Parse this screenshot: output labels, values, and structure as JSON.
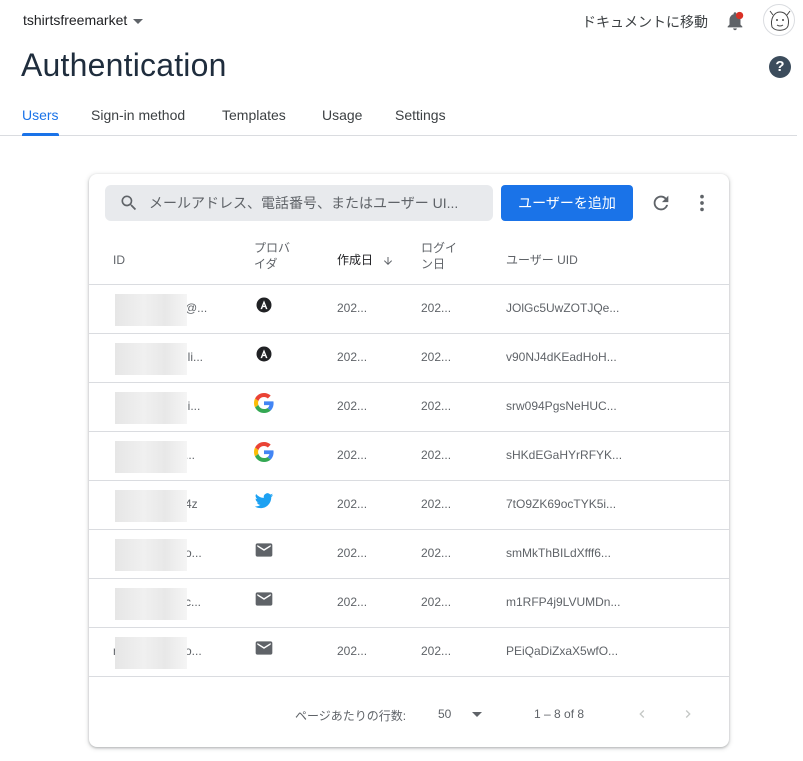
{
  "header": {
    "project_name": "tshirtsfreemarket",
    "docs_link": "ドキュメントに移動",
    "title": "Authentication"
  },
  "tabs": [
    {
      "label": "Users",
      "active": true
    },
    {
      "label": "Sign-in method",
      "active": false
    },
    {
      "label": "Templates",
      "active": false
    },
    {
      "label": "Usage",
      "active": false
    },
    {
      "label": "Settings",
      "active": false
    }
  ],
  "toolbar": {
    "search_placeholder": "メールアドレス、電話番号、またはユーザー UI...",
    "add_user_label": "ユーザーを追加"
  },
  "table": {
    "columns": {
      "id": "ID",
      "provider": "プロバイダ",
      "created": "作成日",
      "signed_in": "ログイン日",
      "uid": "ユーザー UID"
    },
    "rows": [
      {
        "id_tail": "@...",
        "provider_icon": "apple-icon",
        "created": "202...",
        "signed_in": "202...",
        "uid": "JOlGc5UwZOTJQe..."
      },
      {
        "id_tail": "lli...",
        "provider_icon": "apple-icon",
        "created": "202...",
        "signed_in": "202...",
        "uid": "v90NJ4dKEadHoH..."
      },
      {
        "id_tail": "li...",
        "provider_icon": "google-icon",
        "created": "202...",
        "signed_in": "202...",
        "uid": "srw094PgsNeHUC..."
      },
      {
        "id_tail": "...",
        "provider_icon": "google-icon",
        "created": "202...",
        "signed_in": "202...",
        "uid": "sHKdEGaHYrRFYK..."
      },
      {
        "id_tail": "4z",
        "provider_icon": "twitter-icon",
        "created": "202...",
        "signed_in": "202...",
        "uid": "7tO9ZK69ocTYK5i..."
      },
      {
        "id_tail": "o...",
        "provider_icon": "email-icon",
        "created": "202...",
        "signed_in": "202...",
        "uid": "smMkThBILdXfff6..."
      },
      {
        "id_tail": "c...",
        "provider_icon": "email-icon",
        "created": "202...",
        "signed_in": "202...",
        "uid": "m1RFP4j9LVUMDn..."
      },
      {
        "id_tail": "o...",
        "id_head": "n",
        "provider_icon": "email-icon",
        "created": "202...",
        "signed_in": "202...",
        "uid": "PEiQaDiZxaX5wfO..."
      }
    ]
  },
  "pagination": {
    "rows_per_page_label": "ページあたりの行数:",
    "rows_per_page_value": "50",
    "range": "1 – 8 of 8"
  },
  "colors": {
    "accent": "#1a73e8",
    "notification": "#d93025"
  }
}
